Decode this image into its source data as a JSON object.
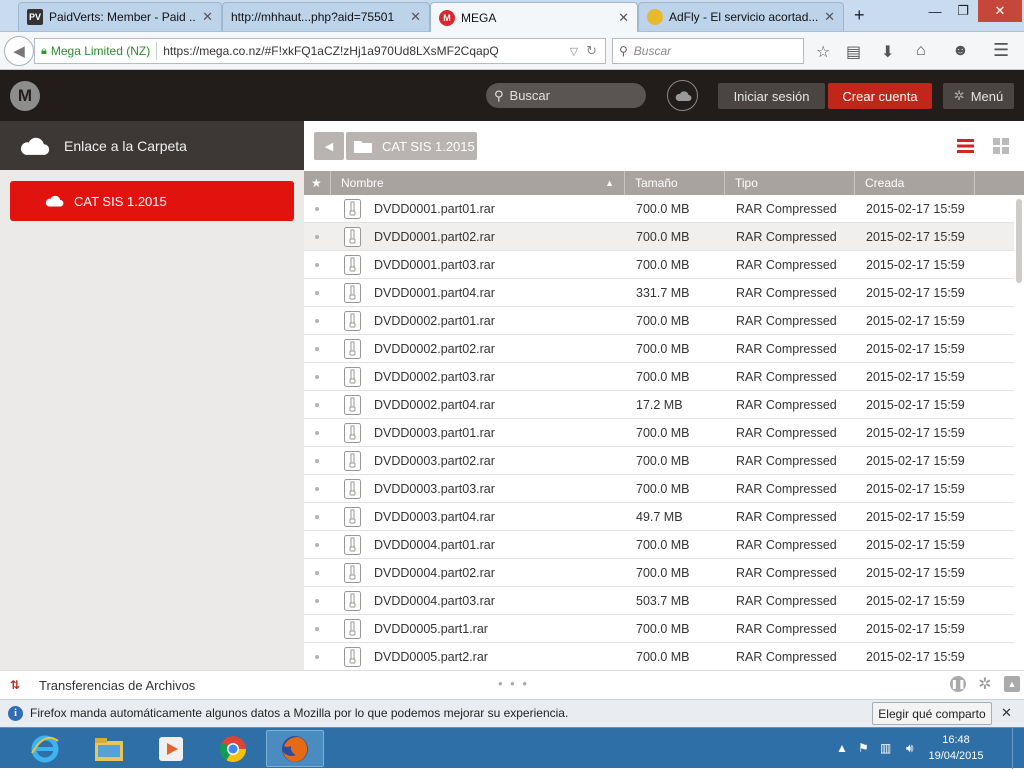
{
  "browser": {
    "tabs": [
      {
        "title": "PaidVerts: Member - Paid ...",
        "favicon": "PV"
      },
      {
        "title": "http://mhhaut...php?aid=75501",
        "favicon": ""
      },
      {
        "title": "MEGA",
        "favicon": "M"
      },
      {
        "title": "AdFly - El servicio acortad...",
        "favicon": ""
      }
    ],
    "new_tab": "+",
    "identity": "Mega Limited (NZ)",
    "url": "https://mega.co.nz/#F!xkFQ1aCZ!zHj1a970Ud8LXsMF2CqapQ",
    "search_placeholder": "Buscar"
  },
  "mega": {
    "search_placeholder": "Buscar",
    "login": "Iniciar sesión",
    "create_account": "Crear cuenta",
    "menu": "Menú",
    "accent_color": "#e1130f"
  },
  "sidebar": {
    "title": "Enlace a la Carpeta",
    "items": [
      {
        "label": "CAT SIS 1.2015"
      }
    ]
  },
  "breadcrumb": {
    "folder": "CAT SIS 1.2015"
  },
  "table": {
    "columns": {
      "star": "★",
      "name": "Nombre",
      "size": "Tamaño",
      "type": "Tipo",
      "created": "Creada"
    },
    "rows": [
      {
        "name": "DVDD0001.part01.rar",
        "size": "700.0 MB",
        "type": "RAR Compressed",
        "created": "2015-02-17 15:59"
      },
      {
        "name": "DVDD0001.part02.rar",
        "size": "700.0 MB",
        "type": "RAR Compressed",
        "created": "2015-02-17 15:59"
      },
      {
        "name": "DVDD0001.part03.rar",
        "size": "700.0 MB",
        "type": "RAR Compressed",
        "created": "2015-02-17 15:59"
      },
      {
        "name": "DVDD0001.part04.rar",
        "size": "331.7 MB",
        "type": "RAR Compressed",
        "created": "2015-02-17 15:59"
      },
      {
        "name": "DVDD0002.part01.rar",
        "size": "700.0 MB",
        "type": "RAR Compressed",
        "created": "2015-02-17 15:59"
      },
      {
        "name": "DVDD0002.part02.rar",
        "size": "700.0 MB",
        "type": "RAR Compressed",
        "created": "2015-02-17 15:59"
      },
      {
        "name": "DVDD0002.part03.rar",
        "size": "700.0 MB",
        "type": "RAR Compressed",
        "created": "2015-02-17 15:59"
      },
      {
        "name": "DVDD0002.part04.rar",
        "size": "17.2 MB",
        "type": "RAR Compressed",
        "created": "2015-02-17 15:59"
      },
      {
        "name": "DVDD0003.part01.rar",
        "size": "700.0 MB",
        "type": "RAR Compressed",
        "created": "2015-02-17 15:59"
      },
      {
        "name": "DVDD0003.part02.rar",
        "size": "700.0 MB",
        "type": "RAR Compressed",
        "created": "2015-02-17 15:59"
      },
      {
        "name": "DVDD0003.part03.rar",
        "size": "700.0 MB",
        "type": "RAR Compressed",
        "created": "2015-02-17 15:59"
      },
      {
        "name": "DVDD0003.part04.rar",
        "size": "49.7 MB",
        "type": "RAR Compressed",
        "created": "2015-02-17 15:59"
      },
      {
        "name": "DVDD0004.part01.rar",
        "size": "700.0 MB",
        "type": "RAR Compressed",
        "created": "2015-02-17 15:59"
      },
      {
        "name": "DVDD0004.part02.rar",
        "size": "700.0 MB",
        "type": "RAR Compressed",
        "created": "2015-02-17 15:59"
      },
      {
        "name": "DVDD0004.part03.rar",
        "size": "503.7 MB",
        "type": "RAR Compressed",
        "created": "2015-02-17 15:59"
      },
      {
        "name": "DVDD0005.part1.rar",
        "size": "700.0 MB",
        "type": "RAR Compressed",
        "created": "2015-02-17 15:59"
      },
      {
        "name": "DVDD0005.part2.rar",
        "size": "700.0 MB",
        "type": "RAR Compressed",
        "created": "2015-02-17 15:59"
      }
    ]
  },
  "transfers": {
    "label": "Transferencias de Archivos",
    "dots": "• • •"
  },
  "notification": {
    "message": "Firefox manda automáticamente algunos datos a Mozilla por lo que podemos mejorar su experiencia.",
    "button": "Elegir qué comparto"
  },
  "taskbar": {
    "time": "16:48",
    "date": "19/04/2015"
  }
}
